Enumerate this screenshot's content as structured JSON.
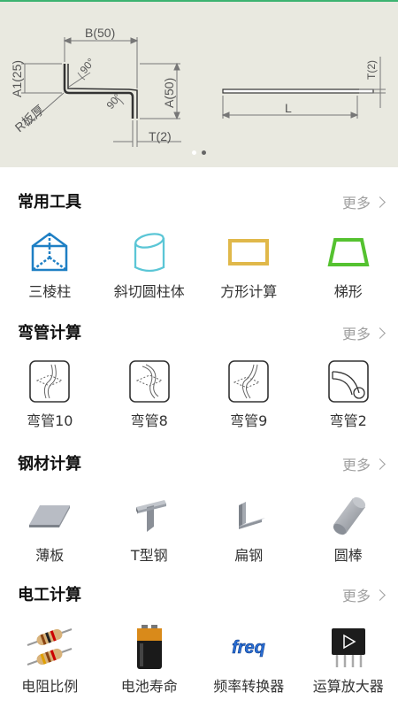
{
  "banner": {
    "diagram_labels": {
      "b": "B(50)",
      "a1": "A1(25)",
      "a": "A(50)",
      "r": "R板厚",
      "t_left": "T(2)",
      "t_right": "T(2)",
      "l": "L",
      "angle1": "90°",
      "angle2": "90°"
    },
    "dots": 2,
    "active_dot": 1
  },
  "sections": [
    {
      "title": "常用工具",
      "more": "更多",
      "items": [
        {
          "label": "三棱柱",
          "icon": "triangular-prism-icon"
        },
        {
          "label": "斜切圆柱体",
          "icon": "oblique-cylinder-icon"
        },
        {
          "label": "方形计算",
          "icon": "square-icon"
        },
        {
          "label": "梯形",
          "icon": "trapezoid-icon"
        }
      ]
    },
    {
      "title": "弯管计算",
      "more": "更多",
      "items": [
        {
          "label": "弯管10",
          "icon": "bent-pipe-icon"
        },
        {
          "label": "弯管8",
          "icon": "bent-pipe-icon"
        },
        {
          "label": "弯管9",
          "icon": "bent-pipe-icon"
        },
        {
          "label": "弯管2",
          "icon": "elbow-pipe-icon"
        }
      ]
    },
    {
      "title": "钢材计算",
      "more": "更多",
      "items": [
        {
          "label": "薄板",
          "icon": "thin-plate-icon"
        },
        {
          "label": "T型钢",
          "icon": "t-steel-icon"
        },
        {
          "label": "扁钢",
          "icon": "angle-steel-icon"
        },
        {
          "label": "圆棒",
          "icon": "round-bar-icon"
        }
      ]
    },
    {
      "title": "电工计算",
      "more": "更多",
      "items": [
        {
          "label": "电阻比例",
          "icon": "resistor-icon"
        },
        {
          "label": "电池寿命",
          "icon": "battery-icon"
        },
        {
          "label": "频率转换器",
          "icon": "freq-icon",
          "icon_text": "freq"
        },
        {
          "label": "运算放大器",
          "icon": "op-amp-chip-icon"
        }
      ]
    }
  ],
  "colors": {
    "accent_line": "#3cb371",
    "prism": "#1e7fc4",
    "cylinder": "#5bc6d6",
    "square": "#e0b84a",
    "trapezoid": "#55c230",
    "more_text": "#a0a0a0",
    "banner_bg": "#e9e9e0"
  }
}
